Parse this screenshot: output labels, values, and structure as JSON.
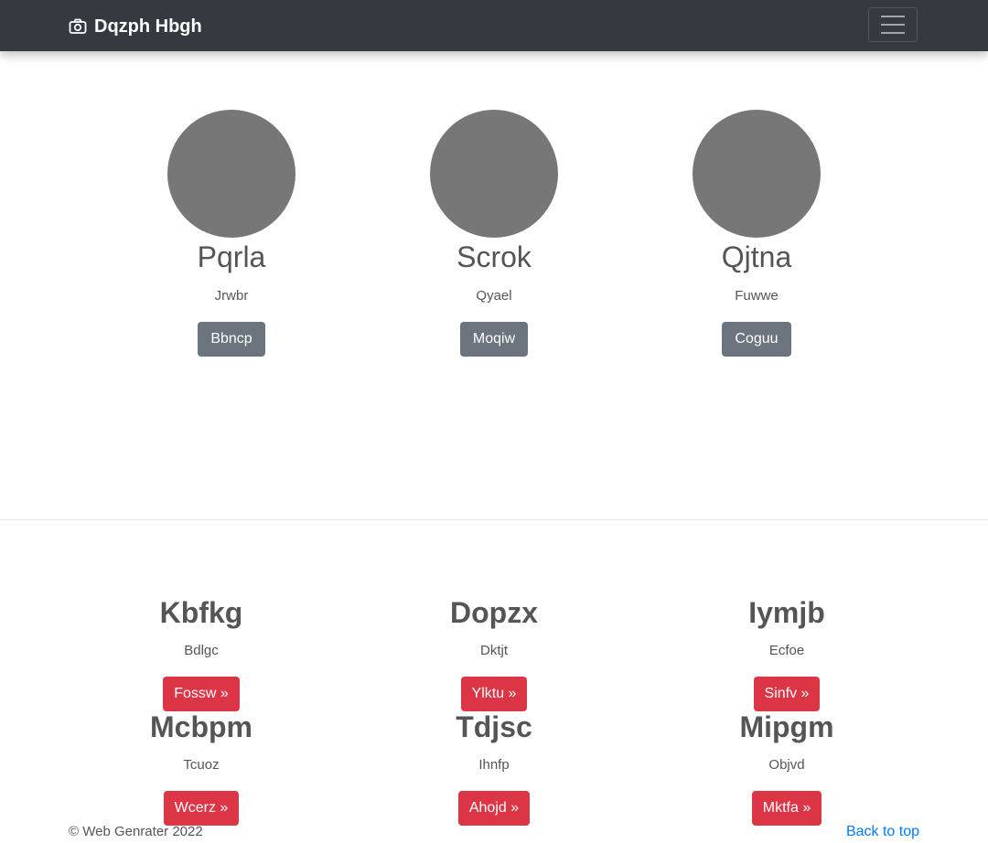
{
  "navbar": {
    "brand": "Dqzph Hbgh",
    "brand_icon": "camera-icon",
    "toggler_icon": "hamburger-menu-icon"
  },
  "profiles": [
    {
      "name": "Pqrla",
      "role": "Jrwbr",
      "button": "Bbncp"
    },
    {
      "name": "Scrok",
      "role": "Qyael",
      "button": "Moqiw"
    },
    {
      "name": "Qjtna",
      "role": "Fuwwe",
      "button": "Coguu"
    }
  ],
  "features": [
    {
      "title": "Kbfkg",
      "desc": "Bdlgc",
      "button": "Fossw »"
    },
    {
      "title": "Dopzx",
      "desc": "Dktjt",
      "button": "Ylktu »"
    },
    {
      "title": "Iymjb",
      "desc": "Ecfoe",
      "button": "Sinfv »"
    },
    {
      "title": "Mcbpm",
      "desc": "Tcuoz",
      "button": "Wcerz »"
    },
    {
      "title": "Tdjsc",
      "desc": "Ihnfp",
      "button": "Ahojd »"
    },
    {
      "title": "Mipgm",
      "desc": "Objvd",
      "button": "Mktfa »"
    }
  ],
  "footer": {
    "copyright": "© Web Genrater 2022",
    "back_to_top": "Back to top"
  },
  "colors": {
    "navbar_bg": "#343a40",
    "secondary_button": "#6c757d",
    "danger_button": "#dc3545",
    "link": "#007bff",
    "avatar_placeholder": "#777777"
  }
}
